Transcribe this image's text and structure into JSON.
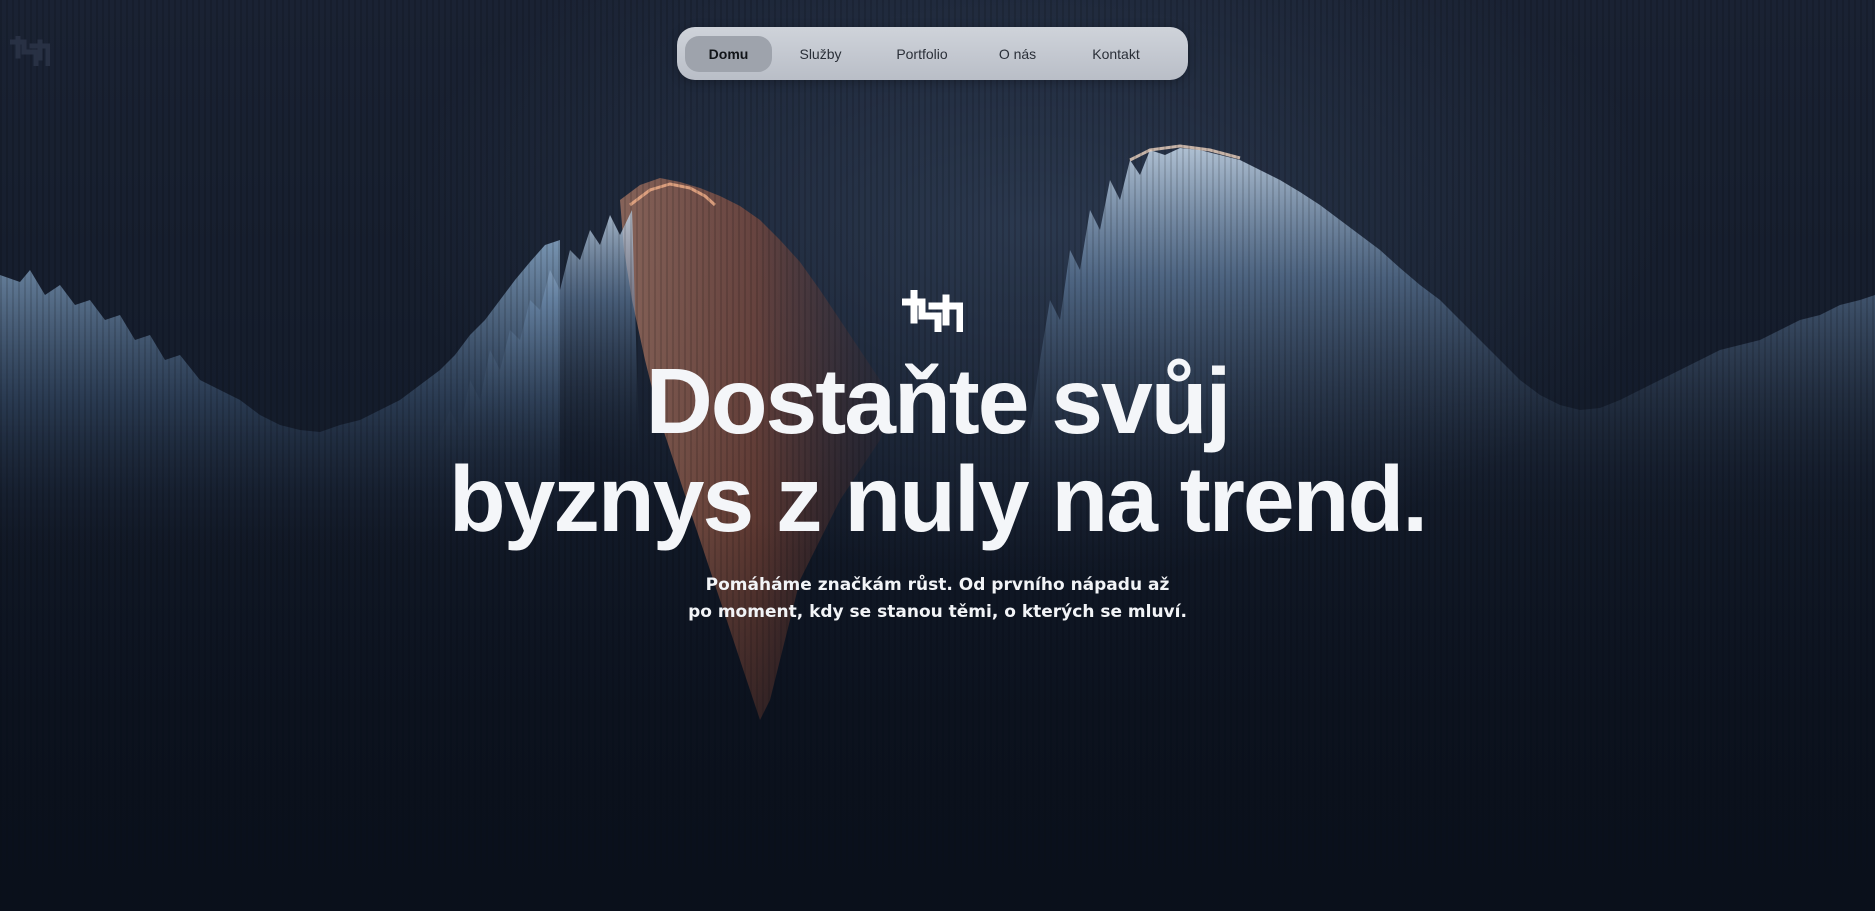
{
  "brand": {
    "logo_icon": "th-monogram-icon",
    "hero_logo_icon": "th-monogram-icon"
  },
  "nav": {
    "items": [
      {
        "label": "Domu",
        "active": true
      },
      {
        "label": "Služby",
        "active": false
      },
      {
        "label": "Portfolio",
        "active": false
      },
      {
        "label": "O nás",
        "active": false
      },
      {
        "label": "Kontakt",
        "active": false
      }
    ]
  },
  "hero": {
    "headline_line1": "Dostaňte svůj",
    "headline_line2": "byznys z nuly na trend.",
    "subtitle_line1": "Pomáháme značkám růst. Od prvního nápadu až",
    "subtitle_line2": "po moment, kdy se stanou těmi, o kterých se mluví."
  },
  "colors": {
    "background": "#0d1422",
    "nav_bg": "#c4c8cf",
    "nav_active": "#9ea3ac",
    "wave_blue": "#a9c4de",
    "wave_orange": "#e07a52",
    "text": "#f4f6f9"
  }
}
